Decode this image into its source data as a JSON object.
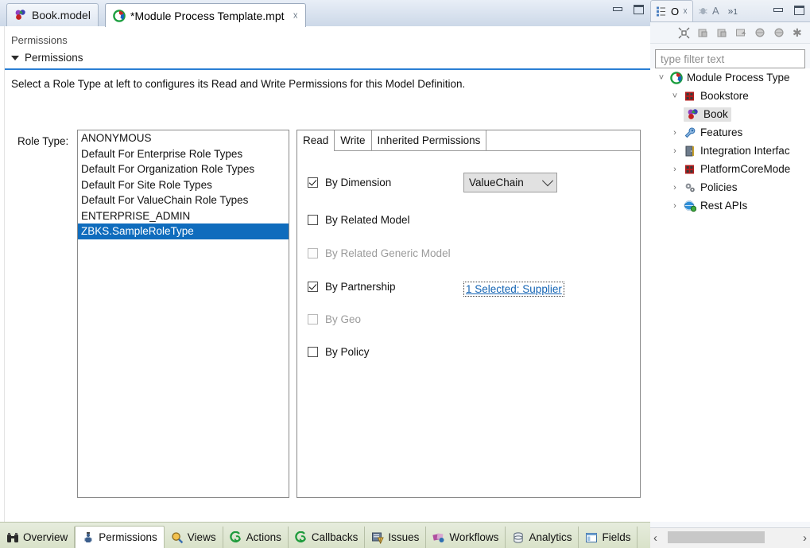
{
  "editor": {
    "tabs": [
      {
        "label": "Book.model",
        "icon": "model-spheres-icon",
        "active": false,
        "closable": false
      },
      {
        "label": "*Module Process Template.mpt",
        "icon": "module-process-icon",
        "active": true,
        "closable": true
      }
    ],
    "window_buttons": {
      "minimize": "minimize-button",
      "maximize": "maximize-button"
    },
    "form_header": "Permissions",
    "section_header": "Permissions",
    "description": "Select a Role Type at left to configures its Read and Write Permissions for this Model Definition.",
    "role_type_label": "Role Type:",
    "role_types": [
      {
        "label": "ANONYMOUS",
        "selected": false
      },
      {
        "label": "Default For Enterprise Role Types",
        "selected": false
      },
      {
        "label": "Default For Organization Role Types",
        "selected": false
      },
      {
        "label": "Default For Site Role Types",
        "selected": false
      },
      {
        "label": "Default For ValueChain Role Types",
        "selected": false
      },
      {
        "label": "ENTERPRISE_ADMIN",
        "selected": false
      },
      {
        "label": "ZBKS.SampleRoleType",
        "selected": true
      }
    ],
    "permission_tabs": [
      {
        "label": "Read",
        "active": true
      },
      {
        "label": "Write",
        "active": false
      },
      {
        "label": "Inherited Permissions",
        "active": false
      }
    ],
    "permission_rows": [
      {
        "label": "By Dimension",
        "checked": true,
        "disabled": false,
        "control": "combo",
        "value": "ValueChain"
      },
      {
        "label": "By Related Model",
        "checked": false,
        "disabled": false,
        "control": "none"
      },
      {
        "label": "By Related Generic Model",
        "checked": false,
        "disabled": true,
        "control": "none"
      },
      {
        "label": "By Partnership",
        "checked": true,
        "disabled": false,
        "control": "link",
        "value": "1 Selected: Supplier"
      },
      {
        "label": "By Geo",
        "checked": false,
        "disabled": true,
        "control": "none"
      },
      {
        "label": "By Policy",
        "checked": false,
        "disabled": false,
        "control": "none"
      }
    ],
    "bottom_tabs": [
      {
        "label": "Overview",
        "icon": "binoculars-icon",
        "active": false
      },
      {
        "label": "Permissions",
        "icon": "person-lock-icon",
        "active": true
      },
      {
        "label": "Views",
        "icon": "magnifier-icon",
        "active": false
      },
      {
        "label": "Actions",
        "icon": "green-swirl-icon",
        "active": false
      },
      {
        "label": "Callbacks",
        "icon": "green-swirl-icon",
        "active": false
      },
      {
        "label": "Issues",
        "icon": "issues-icon",
        "active": false
      },
      {
        "label": "Workflows",
        "icon": "workflows-icon",
        "active": false
      },
      {
        "label": "Analytics",
        "icon": "database-icon",
        "active": false
      },
      {
        "label": "Fields",
        "icon": "fields-icon",
        "active": false
      }
    ]
  },
  "right_view": {
    "tabs": [
      {
        "label": "O",
        "icon": "outline-view-icon",
        "active": true,
        "closable": true
      },
      {
        "label": "A",
        "icon": "debug-bug-icon",
        "active": false,
        "closable": false
      }
    ],
    "overflow_indicator": "1",
    "window_buttons": {
      "minimize": "minimize-button",
      "maximize": "maximize-button"
    },
    "toolbar_icons": [
      "collapse-all-icon",
      "hide-fields-icon",
      "hide-static-icon",
      "show-categories-icon",
      "sort-globe-icon",
      "filter-globe-icon",
      "link-asterisk-icon"
    ],
    "filter_placeholder": "type filter text",
    "tree": [
      {
        "label": "Module Process Type",
        "indent": 0,
        "expander": "expanded",
        "icon": "module-process-icon",
        "selected": false
      },
      {
        "label": "Bookstore",
        "indent": 1,
        "expander": "expanded",
        "icon": "red-model-icon",
        "selected": false
      },
      {
        "label": "Book",
        "indent": 2,
        "expander": "none",
        "icon": "model-spheres-icon",
        "selected": true
      },
      {
        "label": "Features",
        "indent": 1,
        "expander": "collapsed",
        "icon": "wrench-icon",
        "selected": false
      },
      {
        "label": "Integration Interfac",
        "indent": 1,
        "expander": "collapsed",
        "icon": "door-icon",
        "selected": false
      },
      {
        "label": "PlatformCoreMode",
        "indent": 1,
        "expander": "collapsed",
        "icon": "red-model-icon",
        "selected": false
      },
      {
        "label": "Policies",
        "indent": 1,
        "expander": "collapsed",
        "icon": "gears-icon",
        "selected": false
      },
      {
        "label": "Rest APIs",
        "indent": 1,
        "expander": "collapsed",
        "icon": "globe-icon",
        "selected": false
      }
    ],
    "hscroll": {
      "left_arrow": "‹",
      "right_arrow": "›"
    }
  },
  "colors": {
    "selection_blue": "#0f6cbd",
    "link_blue": "#1464b4",
    "section_rule": "#2a7fd4",
    "bottom_tab_bg": "#d9e2c9"
  }
}
